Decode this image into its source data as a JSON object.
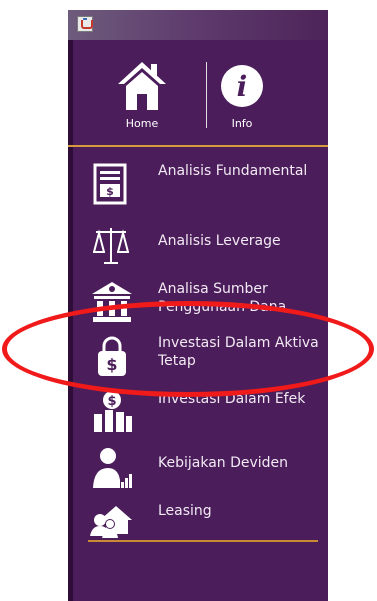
{
  "colors": {
    "panel_background": "#4b1d5a",
    "divider_accent": "#d59b3a",
    "icon_color": "#ffffff",
    "annotation_circle": "#f01a1a"
  },
  "window": {
    "app_icon": "java-cup-icon"
  },
  "topnav": {
    "home": {
      "label": "Home",
      "icon": "home-icon"
    },
    "info": {
      "label": "Info",
      "icon": "info-icon"
    }
  },
  "menu": {
    "items": [
      {
        "label": "Analisis Fundamental",
        "icon": "document-dollar-icon"
      },
      {
        "label": "Analisis Leverage",
        "icon": "scale-balance-icon"
      },
      {
        "label": "Analisa Sumber Penggunaan Dana",
        "icon": "bank-icon"
      },
      {
        "label": "Investasi Dalam Aktiva Tetap",
        "icon": "locked-dollar-icon"
      },
      {
        "label": "Investasi Dalam Efek",
        "icon": "coin-bar-chart-icon"
      },
      {
        "label": "Kebijakan Deviden",
        "icon": "person-chart-icon"
      },
      {
        "label": "Leasing",
        "icon": "people-house-icon"
      }
    ]
  },
  "annotation": {
    "highlighted_item": "Investasi Dalam Aktiva Tetap",
    "shape": "ellipse"
  }
}
